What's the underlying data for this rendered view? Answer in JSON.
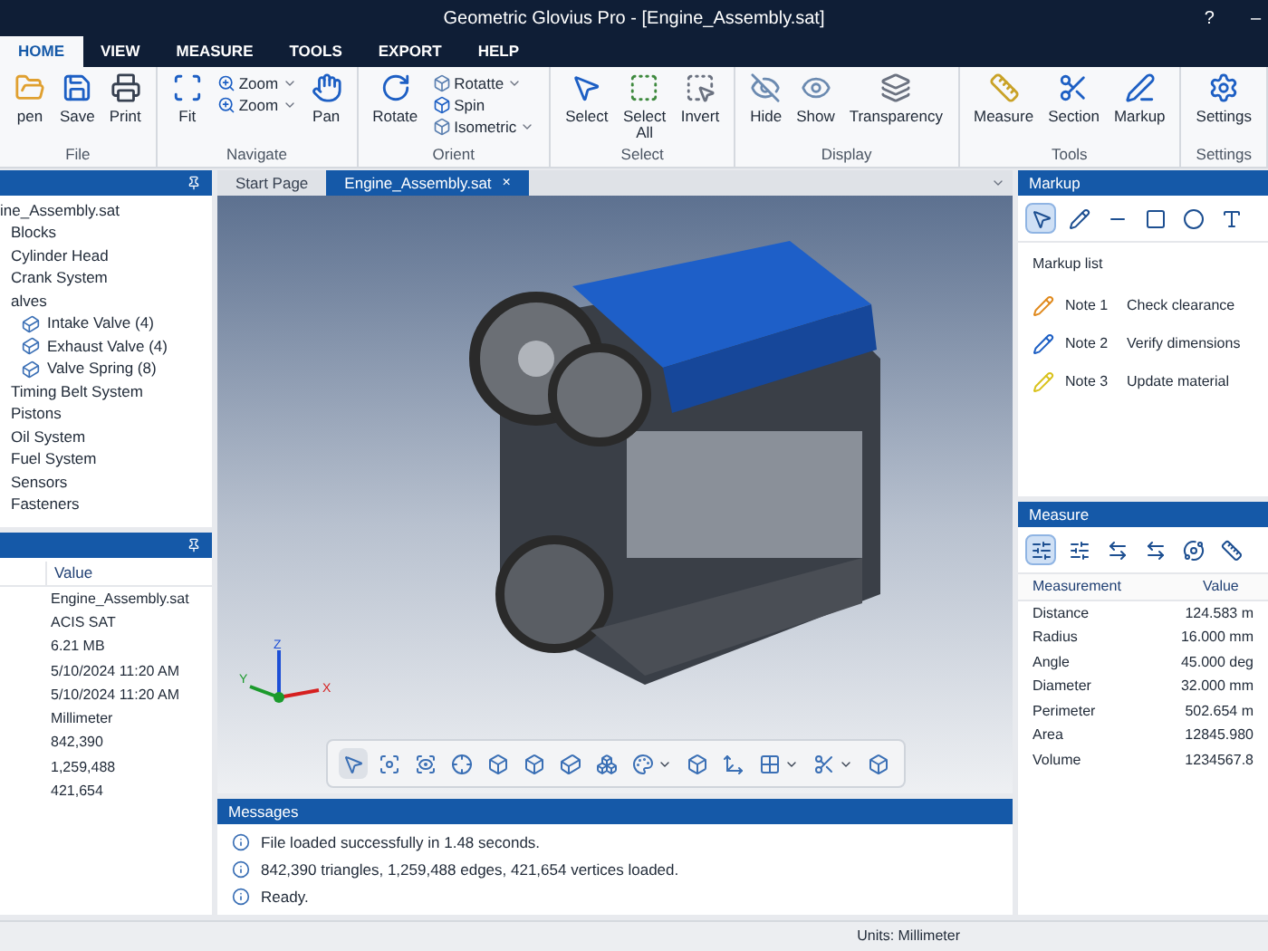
{
  "window": {
    "title": "Geometric Glovius Pro - [Engine_Assembly.sat]",
    "controls": [
      "?",
      "–"
    ]
  },
  "ribbon_tabs": [
    {
      "label": "HOME",
      "selected": true
    },
    {
      "label": "VIEW",
      "selected": false
    },
    {
      "label": "MEASURE",
      "selected": false
    },
    {
      "label": "TOOLS",
      "selected": false
    },
    {
      "label": "EXPORT",
      "selected": false
    },
    {
      "label": "HELP",
      "selected": false
    }
  ],
  "ribbon_groups": [
    {
      "name": "File",
      "items": [
        {
          "label": "pen",
          "kind": "large"
        },
        {
          "label": "Save",
          "kind": "large"
        },
        {
          "label": "Print",
          "kind": "large"
        }
      ]
    },
    {
      "name": "Navigate",
      "items": [
        {
          "label": "Fit",
          "kind": "large"
        },
        {
          "label": "Zoom",
          "kind": "small",
          "dropdown": true
        },
        {
          "label": "Zoom",
          "kind": "small",
          "dropdown": true
        },
        {
          "label": "Pan",
          "kind": "large"
        }
      ]
    },
    {
      "name": "Orient",
      "items": [
        {
          "label": "Rotate",
          "kind": "large"
        },
        {
          "label": "Rotatte",
          "kind": "small",
          "dropdown": true
        },
        {
          "label": "Spin",
          "kind": "small",
          "dropdown": false
        },
        {
          "label": "Isometric",
          "kind": "small",
          "dropdown": true
        }
      ]
    },
    {
      "name": "Select",
      "items": [
        {
          "label": "Select",
          "kind": "large"
        },
        {
          "label": "Select All",
          "kind": "large"
        },
        {
          "label": "Invert",
          "kind": "large"
        }
      ]
    },
    {
      "name": "Display",
      "items": [
        {
          "label": "Hide",
          "kind": "large"
        },
        {
          "label": "Show",
          "kind": "large"
        },
        {
          "label": "Transparency",
          "kind": "large"
        }
      ]
    },
    {
      "name": "Tools",
      "items": [
        {
          "label": "Measure",
          "kind": "large"
        },
        {
          "label": "Section",
          "kind": "large"
        },
        {
          "label": "Markup",
          "kind": "large"
        }
      ]
    },
    {
      "name": "Settings",
      "items": [
        {
          "label": "Settings",
          "kind": "large"
        }
      ]
    }
  ],
  "tree_panel": {
    "items": [
      {
        "label": "ine_Assembly.sat",
        "children": [
          {
            "label": "Blocks"
          },
          {
            "label": "Cylinder Head"
          },
          {
            "label": "Crank System"
          },
          {
            "label": "alves",
            "children": [
              {
                "label": "Intake Valve (4)"
              },
              {
                "label": "Exhaust Valve (4)"
              },
              {
                "label": "Valve Spring (8)"
              }
            ]
          },
          {
            "label": "Timing Belt System"
          },
          {
            "label": "Pistons"
          },
          {
            "label": "Oil System"
          },
          {
            "label": "Fuel System"
          },
          {
            "label": "Sensors"
          },
          {
            "label": "Fasteners"
          }
        ]
      }
    ]
  },
  "properties_panel": {
    "column": "Value",
    "values": [
      "Engine_Assembly.sat",
      "ACIS SAT",
      "6.21 MB",
      "5/10/2024 11:20 AM",
      "5/10/2024 11:20 AM",
      "Millimeter",
      "842,390",
      "1,259,488",
      "421,654"
    ]
  },
  "document_tabs": [
    {
      "label": "Start Page",
      "selected": false
    },
    {
      "label": "Engine_Assembly.sat",
      "selected": true,
      "close": "×"
    }
  ],
  "viewport": {
    "axes": [
      "X",
      "Y",
      "Z"
    ],
    "toolbar": [
      {
        "selected": true
      },
      {
        "selected": false
      },
      {
        "selected": false
      },
      {
        "selected": false
      },
      {
        "selected": false
      },
      {
        "selected": false
      },
      {
        "selected": false
      },
      {
        "selected": false
      },
      {
        "selected": false,
        "dropdown": true
      },
      {
        "selected": false
      },
      {
        "selected": false
      },
      {
        "selected": false,
        "dropdown": true
      },
      {
        "selected": false,
        "dropdown": true
      },
      {
        "selected": false
      }
    ]
  },
  "markup_panel": {
    "title": "Markup",
    "tools": [
      {
        "selected": true
      },
      {
        "selected": false
      },
      {
        "selected": false
      },
      {
        "selected": false
      },
      {
        "selected": false
      },
      {
        "selected": false
      }
    ],
    "list_title": "Markup list",
    "notes": [
      {
        "name": "Note 1",
        "text": "Check clearance",
        "color": "#e08a1e"
      },
      {
        "name": "Note 2",
        "text": "Verify dimensions",
        "color": "#1d5fc4"
      },
      {
        "name": "Note 3",
        "text": "Update material",
        "color": "#d9c21c"
      }
    ]
  },
  "measure_panel": {
    "title": "Measure",
    "tools": [
      {
        "selected": true
      },
      {
        "selected": false
      },
      {
        "selected": false
      },
      {
        "selected": false
      },
      {
        "selected": false
      },
      {
        "selected": false
      }
    ],
    "columns": [
      "Measurement",
      "Value"
    ],
    "rows": [
      [
        "Distance",
        "124.583 m"
      ],
      [
        "Radius",
        "16.000 mm"
      ],
      [
        "Angle",
        "45.000 deg"
      ],
      [
        "Diameter",
        "32.000 mm"
      ],
      [
        "Perimeter",
        "502.654 m"
      ],
      [
        "Area",
        "12845.980"
      ],
      [
        "Volume",
        "1234567.8"
      ]
    ]
  },
  "messages_panel": {
    "title": "Messages",
    "lines": [
      "File loaded successfully in 1.48 seconds.",
      "842,390 triangles, 1,259,488 edges, 421,654 vertices loaded.",
      "Ready."
    ]
  },
  "status_bar": {
    "units": "Units: Millimeter"
  }
}
